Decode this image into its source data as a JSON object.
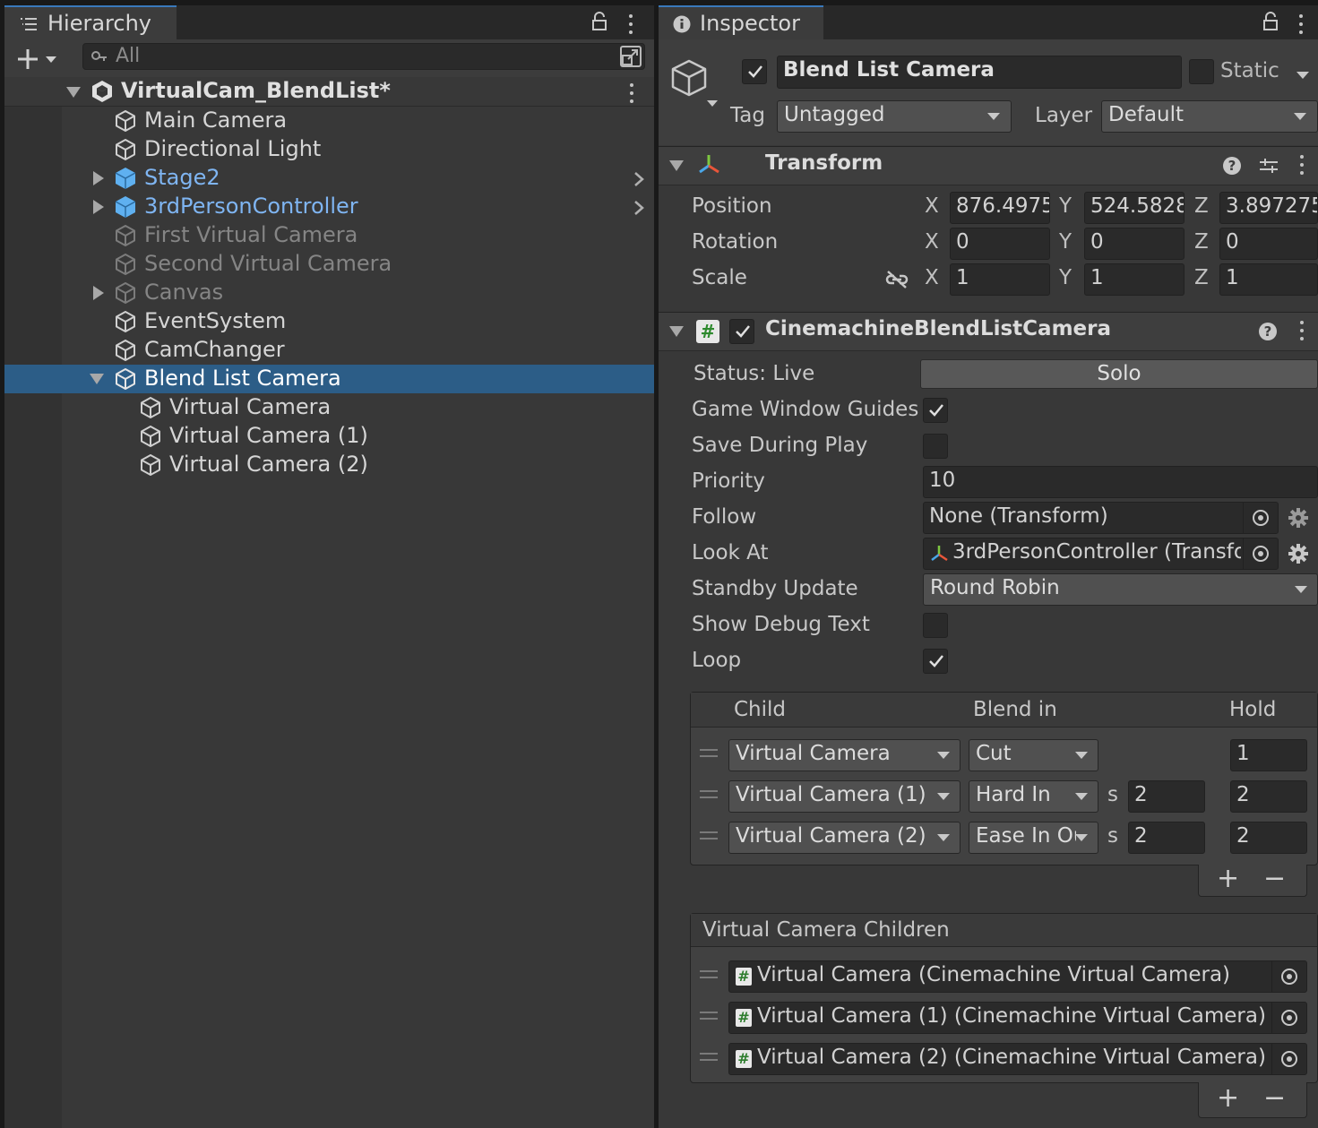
{
  "hierarchy": {
    "tab_label": "Hierarchy",
    "search_placeholder": "All",
    "scene_name": "VirtualCam_BlendList*",
    "items": [
      {
        "label": "Main Camera",
        "style": "normal"
      },
      {
        "label": "Directional Light",
        "style": "normal"
      },
      {
        "label": "Stage2",
        "style": "prefab"
      },
      {
        "label": "3rdPersonController",
        "style": "prefab"
      },
      {
        "label": "First Virtual Camera",
        "style": "disabled"
      },
      {
        "label": "Second Virtual Camera",
        "style": "disabled"
      },
      {
        "label": "Canvas",
        "style": "disabled"
      },
      {
        "label": "EventSystem",
        "style": "normal"
      },
      {
        "label": "CamChanger",
        "style": "normal"
      },
      {
        "label": "Blend List Camera",
        "style": "selected"
      },
      {
        "label": "Virtual Camera",
        "style": "normal"
      },
      {
        "label": "Virtual Camera (1)",
        "style": "normal"
      },
      {
        "label": "Virtual Camera (2)",
        "style": "normal"
      }
    ]
  },
  "inspector": {
    "tab_label": "Inspector",
    "object_name": "Blend List Camera",
    "static_label": "Static",
    "tag_label": "Tag",
    "tag_value": "Untagged",
    "layer_label": "Layer",
    "layer_value": "Default",
    "transform": {
      "title": "Transform",
      "position_label": "Position",
      "rotation_label": "Rotation",
      "scale_label": "Scale",
      "axis_x": "X",
      "axis_y": "Y",
      "axis_z": "Z",
      "position": {
        "x": "876.4975",
        "y": "524.5828",
        "z": "3.897275"
      },
      "rotation": {
        "x": "0",
        "y": "0",
        "z": "0"
      },
      "scale": {
        "x": "1",
        "y": "1",
        "z": "1"
      }
    },
    "component": {
      "title": "CinemachineBlendListCamera",
      "status_label": "Status: Live",
      "solo_label": "Solo",
      "game_window_guides_label": "Game Window Guides",
      "save_during_play_label": "Save During Play",
      "priority_label": "Priority",
      "priority_value": "10",
      "follow_label": "Follow",
      "follow_value": "None (Transform)",
      "look_at_label": "Look At",
      "look_at_value": "3rdPersonController (Transfo",
      "standby_update_label": "Standby Update",
      "standby_update_value": "Round Robin",
      "show_debug_text_label": "Show Debug Text",
      "loop_label": "Loop",
      "instructions": {
        "headers": {
          "child": "Child",
          "blend_in": "Blend in",
          "hold": "Hold"
        },
        "seconds_unit": "s",
        "rows": [
          {
            "child": "Virtual Camera",
            "blend": "Cut",
            "blend_time": "",
            "hold": "1"
          },
          {
            "child": "Virtual Camera (1)",
            "blend": "Hard In",
            "blend_time": "2",
            "hold": "2"
          },
          {
            "child": "Virtual Camera (2)",
            "blend": "Ease In Ou",
            "blend_time": "2",
            "hold": "2"
          }
        ]
      },
      "children_section": {
        "title": "Virtual Camera Children",
        "items": [
          "Virtual Camera (Cinemachine Virtual Camera)",
          "Virtual Camera (1) (Cinemachine Virtual Camera)",
          "Virtual Camera (2) (Cinemachine Virtual Camera)"
        ]
      },
      "add_symbol": "+",
      "remove_symbol": "−"
    }
  },
  "colors": {
    "selection": "#2c5d87",
    "prefab_text": "#7fb5f2",
    "tab_accent": "#3a79bb"
  }
}
